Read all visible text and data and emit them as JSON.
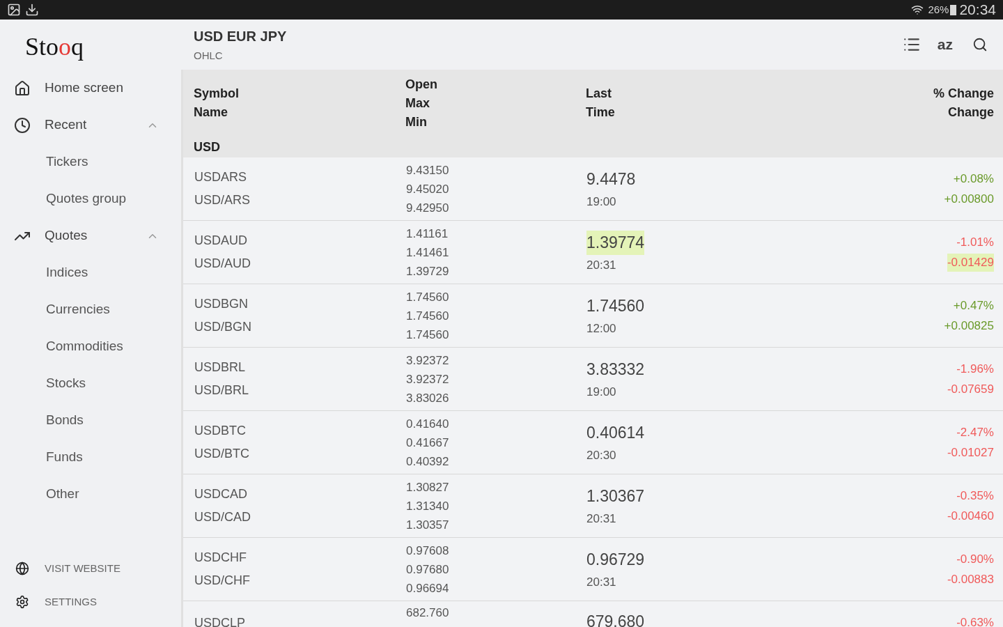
{
  "status_bar": {
    "battery": "26%",
    "time": "20:34"
  },
  "sidebar": {
    "logo": [
      {
        "text": "Sto",
        "color": "#111111"
      },
      {
        "text": "o",
        "color": "#e53935"
      },
      {
        "text": "q",
        "color": "#111111"
      }
    ],
    "items": [
      {
        "label": "Home screen"
      },
      {
        "label": "Recent",
        "expanded": true,
        "children": [
          {
            "label": "Tickers"
          },
          {
            "label": "Quotes group"
          }
        ]
      },
      {
        "label": "Quotes",
        "expanded": true,
        "children": [
          {
            "label": "Indices"
          },
          {
            "label": "Currencies"
          },
          {
            "label": "Commodities"
          },
          {
            "label": "Stocks"
          },
          {
            "label": "Bonds"
          },
          {
            "label": "Funds"
          },
          {
            "label": "Other"
          }
        ]
      }
    ],
    "footer": [
      {
        "label": "VISIT WEBSITE"
      },
      {
        "label": "SETTINGS"
      }
    ]
  },
  "header": {
    "title": "USD EUR JPY",
    "subtitle": "OHLC",
    "sort_label": "az"
  },
  "table": {
    "columns": [
      [
        "Symbol",
        "Name"
      ],
      [
        "Open",
        "Max",
        "Min"
      ],
      [
        "Last",
        "Time"
      ],
      [
        "% Change",
        "Change"
      ]
    ],
    "group": "USD",
    "rows": [
      {
        "symbol": "USDARS",
        "name": "USD/ARS",
        "open": "9.43150",
        "max": "9.45020",
        "min": "9.42950",
        "last": "9.4478",
        "time": "19:00",
        "pct": "+0.08%",
        "change": "+0.00800",
        "color": "#6a9a2a",
        "last_highlighted": false,
        "change_highlighted": false
      },
      {
        "symbol": "USDAUD",
        "name": "USD/AUD",
        "open": "1.41161",
        "max": "1.41461",
        "min": "1.39729",
        "last": "1.39774",
        "time": "20:31",
        "pct": "-1.01%",
        "change": "-0.01429",
        "color": "#f05a5a",
        "last_highlighted": true,
        "change_highlighted": true
      },
      {
        "symbol": "USDBGN",
        "name": "USD/BGN",
        "open": "1.74560",
        "max": "1.74560",
        "min": "1.74560",
        "last": "1.74560",
        "time": "12:00",
        "pct": "+0.47%",
        "change": "+0.00825",
        "color": "#6a9a2a",
        "last_highlighted": false,
        "change_highlighted": false
      },
      {
        "symbol": "USDBRL",
        "name": "USD/BRL",
        "open": "3.92372",
        "max": "3.92372",
        "min": "3.83026",
        "last": "3.83332",
        "time": "19:00",
        "pct": "-1.96%",
        "change": "-0.07659",
        "color": "#f05a5a",
        "last_highlighted": false,
        "change_highlighted": false
      },
      {
        "symbol": "USDBTC",
        "name": "USD/BTC",
        "open": "0.41640",
        "max": "0.41667",
        "min": "0.40392",
        "last": "0.40614",
        "time": "20:30",
        "pct": "-2.47%",
        "change": "-0.01027",
        "color": "#f05a5a",
        "last_highlighted": false,
        "change_highlighted": false
      },
      {
        "symbol": "USDCAD",
        "name": "USD/CAD",
        "open": "1.30827",
        "max": "1.31340",
        "min": "1.30357",
        "last": "1.30367",
        "time": "20:31",
        "pct": "-0.35%",
        "change": "-0.00460",
        "color": "#f05a5a",
        "last_highlighted": false,
        "change_highlighted": false
      },
      {
        "symbol": "USDCHF",
        "name": "USD/CHF",
        "open": "0.97608",
        "max": "0.97680",
        "min": "0.96694",
        "last": "0.96729",
        "time": "20:31",
        "pct": "-0.90%",
        "change": "-0.00883",
        "color": "#f05a5a",
        "last_highlighted": false,
        "change_highlighted": false
      },
      {
        "symbol": "USDCLP",
        "open": "682.760",
        "last": "679.680",
        "pct": "-0.63%",
        "color": "#f05a5a",
        "last_highlighted": false
      }
    ]
  }
}
